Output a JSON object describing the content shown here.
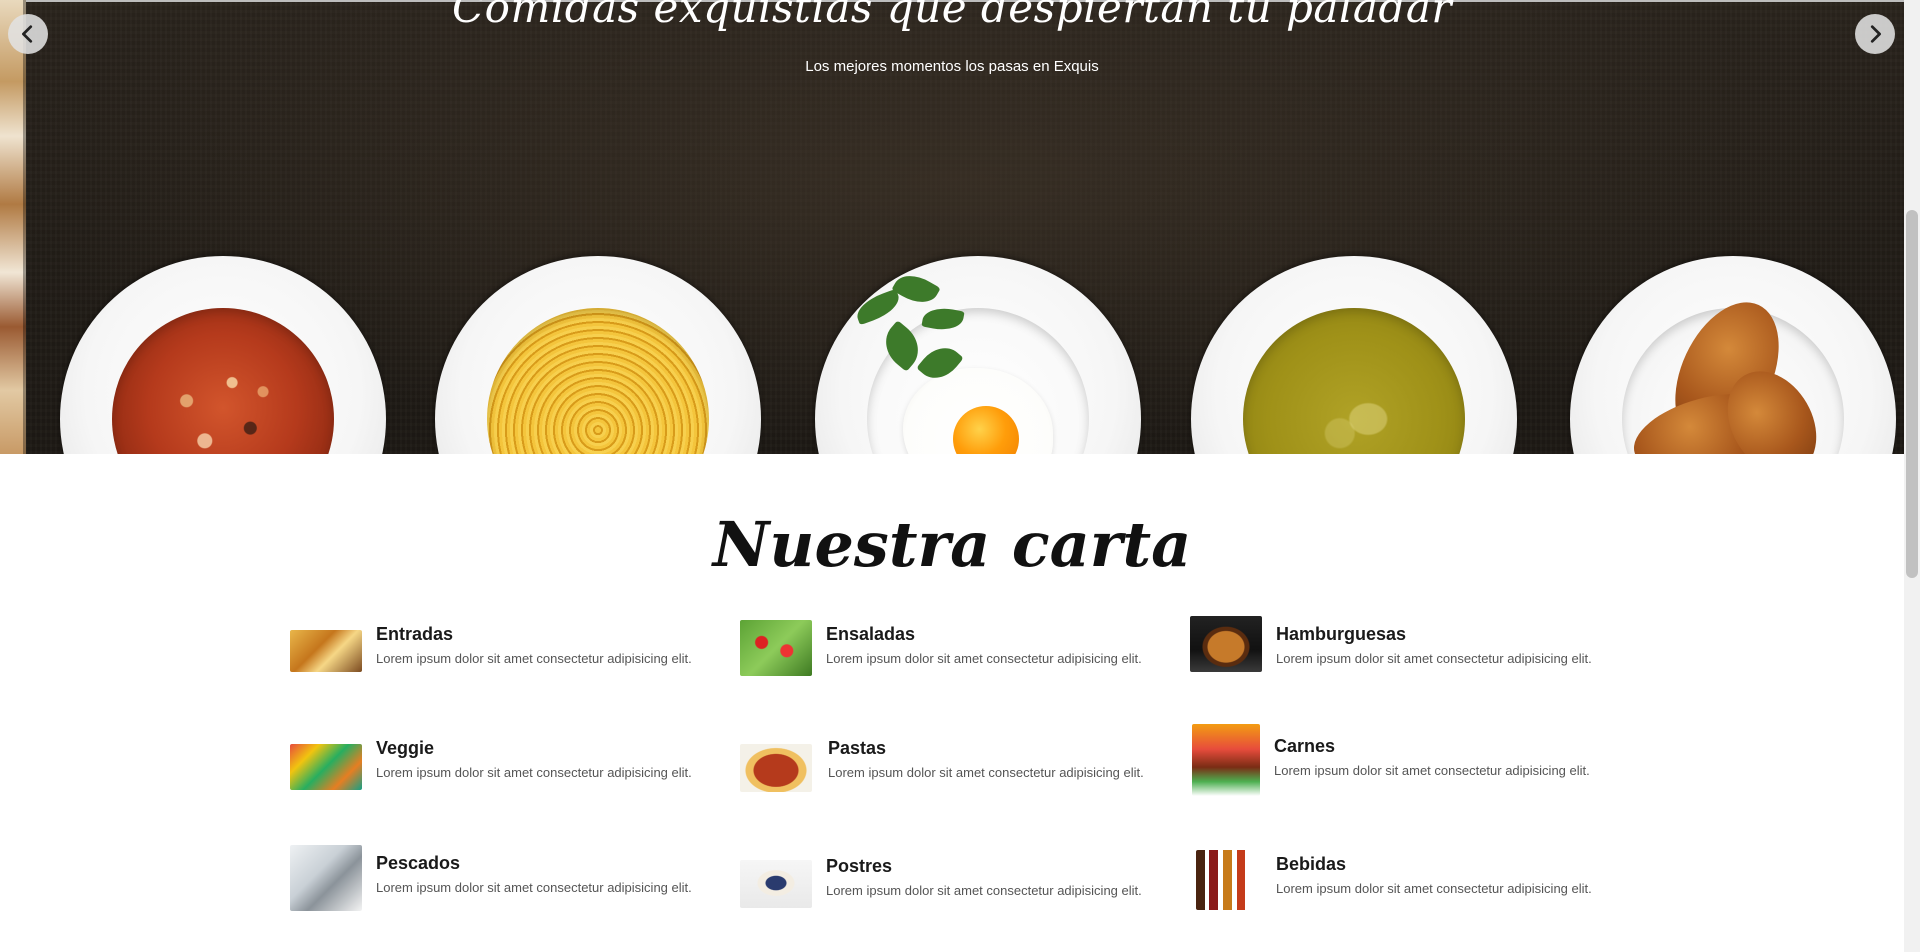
{
  "hero": {
    "title": "Comidas exquistias que despiertan tu paladar",
    "subtitle": "Los mejores momentos los pasas en Exquis",
    "prev_icon": "chevron-left-icon",
    "next_icon": "chevron-right-icon"
  },
  "menu": {
    "title": "Nuestra carta",
    "items": [
      {
        "name": "Entradas",
        "desc": "Lorem ipsum dolor sit amet consectetur adipisicing elit."
      },
      {
        "name": "Ensaladas",
        "desc": "Lorem ipsum dolor sit amet consectetur adipisicing elit."
      },
      {
        "name": "Hamburguesas",
        "desc": "Lorem ipsum dolor sit amet consectetur adipisicing elit."
      },
      {
        "name": "Veggie",
        "desc": "Lorem ipsum dolor sit amet consectetur adipisicing elit."
      },
      {
        "name": "Pastas",
        "desc": "Lorem ipsum dolor sit amet consectetur adipisicing elit."
      },
      {
        "name": "Carnes",
        "desc": "Lorem ipsum dolor sit amet consectetur adipisicing elit."
      },
      {
        "name": "Pescados",
        "desc": "Lorem ipsum dolor sit amet consectetur adipisicing elit."
      },
      {
        "name": "Postres",
        "desc": "Lorem ipsum dolor sit amet consectetur adipisicing elit."
      },
      {
        "name": "Bebidas",
        "desc": "Lorem ipsum dolor sit amet consectetur adipisicing elit."
      }
    ]
  }
}
